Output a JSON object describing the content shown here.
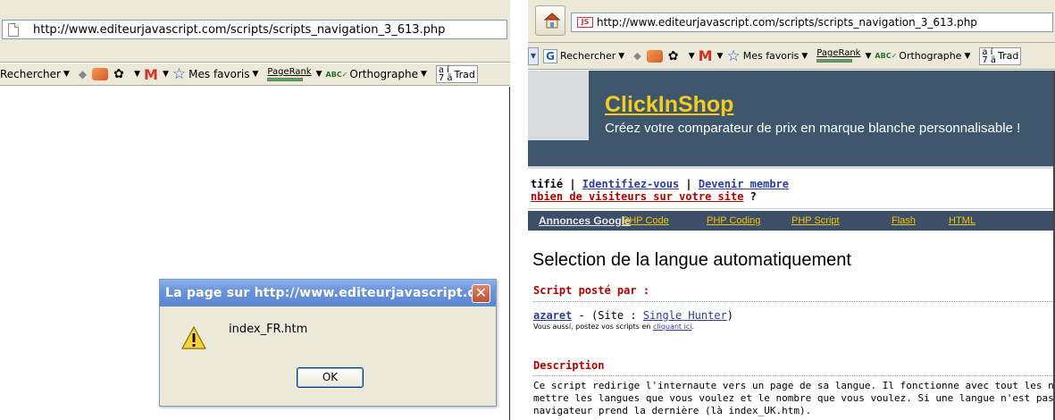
{
  "left": {
    "address_url": "http://www.editeurjavascript.com/scripts/scripts_navigation_3_613.php",
    "toolbar": {
      "search_label": "Rechercher",
      "favorites_label": "Mes favoris",
      "pagerank_label": "PageRank",
      "spell_label": "Orthographe",
      "translate_label": "Trad",
      "translate_glyph_top": "a í",
      "translate_glyph_bottom": "7 ä"
    },
    "dialog": {
      "title": "La page sur http://www.editeurjavascript.c...",
      "message": "index_FR.htm",
      "ok_label": "OK",
      "close_glyph": "✕"
    }
  },
  "right": {
    "address_url": "http://www.editeurjavascript.com/scripts/scripts_navigation_3_613.php",
    "favicon_text": "JS",
    "toolbar": {
      "google_letter": "G",
      "search_label": "Rechercher",
      "favorites_label": "Mes favoris",
      "pagerank_label": "PageRank",
      "spell_label": "Orthographe",
      "translate_label": "Trad",
      "translate_glyph_top": "a í",
      "translate_glyph_bottom": "7 ä"
    },
    "banner": {
      "title": "ClickInShop",
      "tagline": "Créez votre comparateur de prix en marque blanche personnalisable !",
      "title_color": "#f5cc1d",
      "bg_color": "#3e576c"
    },
    "links": {
      "line1_prefix": "tifié | ",
      "identify": "Identifiez-vous",
      "sep": " | ",
      "become_member": "Devenir membre",
      "line2_link": "nbien de visiteurs sur votre site",
      "line2_suffix": " ?"
    },
    "ads": {
      "label": "Annonces Google",
      "items": [
        "PHP Code",
        "PHP Coding",
        "PHP Script",
        "Flash",
        "HTML"
      ]
    },
    "page_title": "Selection de la langue automatiquement",
    "posted_by_heading": "Script posté par :",
    "author": {
      "name": "azaret",
      "site_prefix": " - (Site : ",
      "site_name": "Single Hunter",
      "site_suffix": ")"
    },
    "post_invite_prefix": "Vous aussi, postez vos scripts en ",
    "post_invite_link": "cliquant ici",
    "post_invite_suffix": ".",
    "description_heading": "Description",
    "description_lines": [
      "Ce script redirige l'internaute vers un page de sa langue. Il fonctionne avec tout les navigat",
      "mettre les langues que vous voulez et le nombre que vous voulez. Si une langue n'est pas",
      "navigateur prend la dernière (là index_UK.htm)."
    ]
  }
}
